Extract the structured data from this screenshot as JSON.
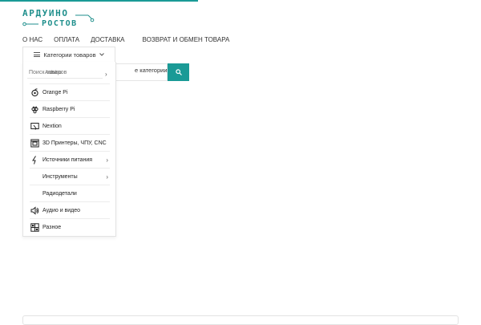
{
  "logo": {
    "line1": "АРДУИНО",
    "line2": "РОСТОВ"
  },
  "nav": [
    "О НАС",
    "ОПЛАТА",
    "ДОСТАВКА",
    "ВОЗВРАТ И ОБМЕН ТОВАРА"
  ],
  "categories_button": {
    "label": "Категории товаров"
  },
  "search": {
    "placeholder": "Поиск товаров",
    "category": "е категории"
  },
  "menu": {
    "arduino": "Arduino",
    "items": [
      {
        "label": "Orange Pi",
        "icon": "orange-pi-icon",
        "submenu": false
      },
      {
        "label": "Raspberry Pi",
        "icon": "raspberry-pi-icon",
        "submenu": false
      },
      {
        "label": "Nextion",
        "icon": "nextion-icon",
        "submenu": false
      },
      {
        "label": "3D Принтеры, ЧПУ, CNC",
        "icon": "3d-printer-icon",
        "submenu": false
      },
      {
        "label": "Источники питания",
        "icon": "power-supply-icon",
        "submenu": true
      },
      {
        "label": "Инструменты",
        "icon": "",
        "submenu": true
      },
      {
        "label": "Радиодетали",
        "icon": "",
        "submenu": false
      },
      {
        "label": "Аудио и видео",
        "icon": "speaker-icon",
        "submenu": false
      },
      {
        "label": "Разное",
        "icon": "misc-icon",
        "submenu": false
      }
    ]
  },
  "colors": {
    "accent": "#1a9a96"
  }
}
